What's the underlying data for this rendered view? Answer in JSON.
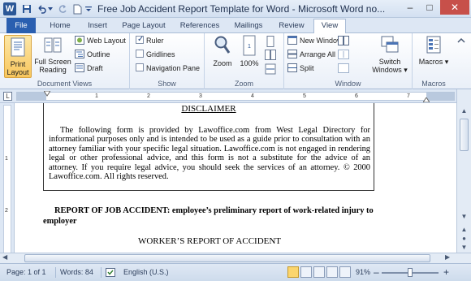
{
  "window": {
    "title": "Free Job Accident Report Template for Word  -  Microsoft Word no...",
    "app_icon": "W",
    "controls": {
      "minimize": "–",
      "maximize": "□",
      "close": "✕"
    }
  },
  "quick_access": {
    "icons": [
      "save-icon",
      "undo-icon",
      "redo-icon",
      "new-document-icon",
      "customize-arrow-icon"
    ]
  },
  "tabs": [
    {
      "label": "File"
    },
    {
      "label": "Home"
    },
    {
      "label": "Insert"
    },
    {
      "label": "Page Layout"
    },
    {
      "label": "References"
    },
    {
      "label": "Mailings"
    },
    {
      "label": "Review"
    },
    {
      "label": "View"
    }
  ],
  "active_tab": "View",
  "ribbon": {
    "document_views": {
      "label": "Document Views",
      "print_layout": "Print\nLayout",
      "print_layout_1": "Print",
      "print_layout_2": "Layout",
      "full_screen_1": "Full Screen",
      "full_screen_2": "Reading",
      "web_layout": "Web Layout",
      "outline": "Outline",
      "draft": "Draft"
    },
    "show": {
      "label": "Show",
      "ruler": "Ruler",
      "gridlines": "Gridlines",
      "navigation_pane": "Navigation Pane",
      "ruler_checked": true,
      "gridlines_checked": false,
      "navigation_checked": false
    },
    "zoom": {
      "label": "Zoom",
      "zoom_button": "Zoom",
      "hundred_percent": "100%"
    },
    "window_group": {
      "label": "Window",
      "new_window": "New Window",
      "arrange_all": "Arrange All",
      "split": "Split",
      "switch_windows_1": "Switch",
      "switch_windows_2": "Windows ▾"
    },
    "macros": {
      "label": "Macros",
      "macros_button": "Macros ▾"
    }
  },
  "ruler": {
    "numbers": [
      "1",
      "2",
      "3",
      "4",
      "5",
      "6",
      "7"
    ]
  },
  "document": {
    "disclaimer_title": "DISCLAIMER",
    "disclaimer_text": "The following form is provided by Lawoffice.com from West Legal Directory for informational purposes only and is intended to be used as a guide prior to consultation with an attorney familiar with your specific legal situation. Lawoffice.com is not engaged in rendering legal or other professional advice, and this form is not a substitute for the advice of an attorney. If you require legal advice, you should seek the services of an attorney. © 2000 Lawoffice.com. All rights reserved.",
    "report_heading": "REPORT OF JOB ACCIDENT: employee’s preliminary report of work-related injury to employer",
    "workers_heading": "WORKER’S REPORT OF ACCIDENT"
  },
  "status": {
    "page": "Page: 1 of 1",
    "words": "Words: 84",
    "language": "English (U.S.)",
    "zoom": "91%",
    "zoom_minus": "–",
    "zoom_plus": "+"
  }
}
